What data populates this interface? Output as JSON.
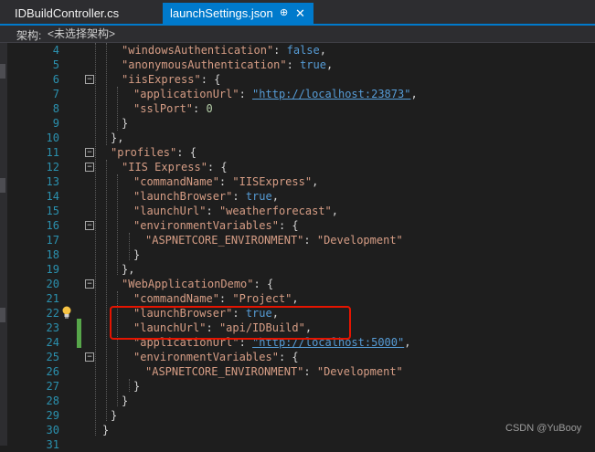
{
  "tabs": [
    {
      "label": "IDBuildController.cs",
      "active": false
    },
    {
      "label": "launchSettings.json",
      "active": true,
      "pin": "⊕",
      "close": "✕"
    }
  ],
  "navbar": {
    "label": "架构:",
    "selected": "<未选择架构>"
  },
  "lines": [
    {
      "n": "4",
      "fold": "",
      "html": ""
    },
    {
      "n": "5",
      "fold": "",
      "html": ""
    },
    {
      "n": "6",
      "fold": "⊟",
      "html": ""
    },
    {
      "n": "7",
      "fold": "",
      "html": ""
    },
    {
      "n": "8",
      "fold": "",
      "html": ""
    },
    {
      "n": "9",
      "fold": "",
      "html": ""
    },
    {
      "n": "10",
      "fold": "",
      "html": ""
    },
    {
      "n": "11",
      "fold": "⊟",
      "html": ""
    },
    {
      "n": "12",
      "fold": "⊟",
      "html": ""
    },
    {
      "n": "13",
      "fold": "",
      "html": ""
    },
    {
      "n": "14",
      "fold": "",
      "html": ""
    },
    {
      "n": "15",
      "fold": "",
      "html": ""
    },
    {
      "n": "16",
      "fold": "⊟",
      "html": ""
    },
    {
      "n": "17",
      "fold": "",
      "html": ""
    },
    {
      "n": "18",
      "fold": "",
      "html": ""
    },
    {
      "n": "19",
      "fold": "",
      "html": ""
    },
    {
      "n": "20",
      "fold": "⊟",
      "html": ""
    },
    {
      "n": "21",
      "fold": "",
      "html": ""
    },
    {
      "n": "22",
      "fold": "",
      "html": ""
    },
    {
      "n": "23",
      "fold": "",
      "html": ""
    },
    {
      "n": "24",
      "fold": "",
      "html": ""
    },
    {
      "n": "25",
      "fold": "⊟",
      "html": ""
    },
    {
      "n": "26",
      "fold": "",
      "html": ""
    },
    {
      "n": "27",
      "fold": "",
      "html": ""
    },
    {
      "n": "28",
      "fold": "",
      "html": ""
    },
    {
      "n": "29",
      "fold": "",
      "html": ""
    },
    {
      "n": "30",
      "fold": "",
      "html": ""
    },
    {
      "n": "31",
      "fold": "",
      "html": ""
    }
  ],
  "code": {
    "l4": [
      "\"windowsAuthentication\"",
      ": ",
      "false",
      ","
    ],
    "l5": [
      "\"anonymousAuthentication\"",
      ": ",
      "true",
      ","
    ],
    "l6": [
      "\"iisExpress\"",
      ": {"
    ],
    "l7": [
      "\"applicationUrl\"",
      ": ",
      "\"http://localhost:23873\"",
      ","
    ],
    "l8": [
      "\"sslPort\"",
      ": ",
      "0"
    ],
    "l9": [
      "}"
    ],
    "l10": [
      "},"
    ],
    "l11": [
      "\"profiles\"",
      ": {"
    ],
    "l12": [
      "\"IIS Express\"",
      ": {"
    ],
    "l13": [
      "\"commandName\"",
      ": ",
      "\"IISExpress\"",
      ","
    ],
    "l14": [
      "\"launchBrowser\"",
      ": ",
      "true",
      ","
    ],
    "l15": [
      "\"launchUrl\"",
      ": ",
      "\"weatherforecast\"",
      ","
    ],
    "l16": [
      "\"environmentVariables\"",
      ": {"
    ],
    "l17": [
      "\"ASPNETCORE_ENVIRONMENT\"",
      ": ",
      "\"Development\""
    ],
    "l18": [
      "}"
    ],
    "l19": [
      "},"
    ],
    "l20": [
      "\"WebApplicationDemo\"",
      ": {"
    ],
    "l21": [
      "\"commandName\"",
      ": ",
      "\"Project\"",
      ","
    ],
    "l22": [
      "\"launchBrowser\"",
      ": ",
      "true",
      ","
    ],
    "l23": [
      "\"launchUrl\"",
      ": ",
      "\"api/IDBuild\"",
      ","
    ],
    "l24": [
      "\"applicationUrl\"",
      ": ",
      "\"http://localhost:5000\"",
      ","
    ],
    "l25": [
      "\"environmentVariables\"",
      ": {"
    ],
    "l26": [
      "\"ASPNETCORE_ENVIRONMENT\"",
      ": ",
      "\"Development\""
    ],
    "l27": [
      "}"
    ],
    "l28": [
      "}"
    ],
    "l29": [
      "}"
    ],
    "l30": [
      "}"
    ],
    "l31": [
      ""
    ]
  },
  "watermark": "CSDN @YuBooy",
  "colors": {
    "accent": "#007acc",
    "highlight_box": "#e51400",
    "line_number": "#2b91af",
    "string": "#d69d85",
    "keyword": "#569cd6"
  }
}
